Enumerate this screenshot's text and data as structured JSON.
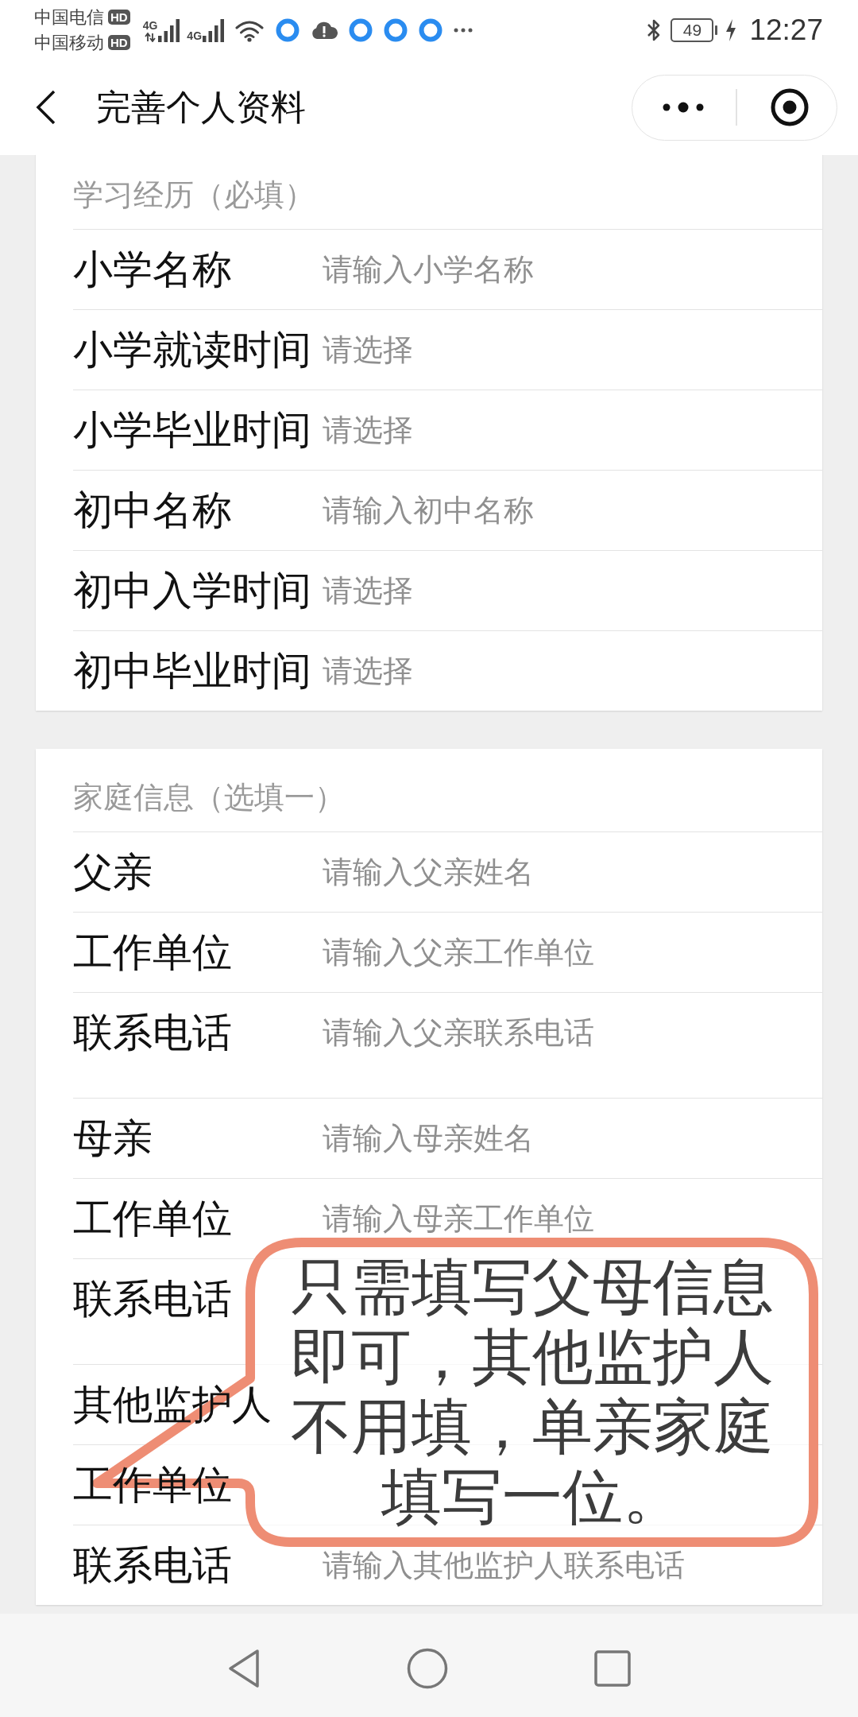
{
  "status_bar": {
    "carriers": [
      {
        "name": "中国电信",
        "badge": "HD"
      },
      {
        "name": "中国移动",
        "badge": "HD"
      }
    ],
    "signals": [
      {
        "label": "4G",
        "activity": true
      },
      {
        "label": "4G",
        "activity": false
      }
    ],
    "battery": "49",
    "time": "12:27"
  },
  "nav": {
    "title": "完善个人资料"
  },
  "sections": [
    {
      "title": "学习经历（必填）",
      "groups": [
        {
          "fields": [
            {
              "label": "小学名称",
              "placeholder": "请输入小学名称"
            },
            {
              "label": "小学就读时间",
              "placeholder": "请选择"
            },
            {
              "label": "小学毕业时间",
              "placeholder": "请选择"
            },
            {
              "label": "初中名称",
              "placeholder": "请输入初中名称"
            },
            {
              "label": "初中入学时间",
              "placeholder": "请选择"
            },
            {
              "label": "初中毕业时间",
              "placeholder": "请选择"
            }
          ]
        }
      ]
    },
    {
      "title": "家庭信息（选填一）",
      "groups": [
        {
          "fields": [
            {
              "label": "父亲",
              "placeholder": "请输入父亲姓名"
            },
            {
              "label": "工作单位",
              "placeholder": "请输入父亲工作单位"
            },
            {
              "label": "联系电话",
              "placeholder": "请输入父亲联系电话"
            }
          ]
        },
        {
          "fields": [
            {
              "label": "母亲",
              "placeholder": "请输入母亲姓名"
            },
            {
              "label": "工作单位",
              "placeholder": "请输入母亲工作单位"
            },
            {
              "label": "联系电话"
            }
          ]
        },
        {
          "fields": [
            {
              "label": "其他监护人"
            },
            {
              "label": "工作单位"
            },
            {
              "label": "联系电话",
              "placeholder": "请输入其他监护人联系电话"
            }
          ]
        }
      ]
    }
  ],
  "callout": {
    "text": "只需填写父母信息即可，其他监护人不用填，单亲家庭填写一位。"
  }
}
